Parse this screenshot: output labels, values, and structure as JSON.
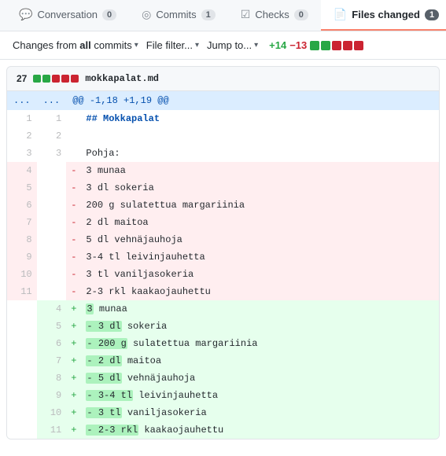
{
  "tabs": [
    {
      "id": "conversation",
      "label": "Conversation",
      "icon": "💬",
      "badge": "0",
      "active": false
    },
    {
      "id": "commits",
      "label": "Commits",
      "icon": "◎",
      "badge": "1",
      "active": false
    },
    {
      "id": "checks",
      "label": "Checks",
      "icon": "☑",
      "badge": "0",
      "active": false
    },
    {
      "id": "files-changed",
      "label": "Files changed",
      "icon": "📄",
      "badge": "1",
      "active": true
    }
  ],
  "filters": {
    "commits": "Changes from all commits",
    "commits_caret": "▾",
    "file_filter": "File filter...",
    "file_filter_caret": "▾",
    "jump_to": "Jump to...",
    "jump_to_caret": "▾",
    "diff_add": "+14",
    "diff_del": "−13",
    "blocks": [
      "green",
      "green",
      "red",
      "red",
      "red"
    ]
  },
  "file": {
    "count": "27",
    "blocks": [
      "green",
      "green",
      "red",
      "red",
      "red"
    ],
    "name": "mokkapalat.md",
    "hunk": "@@ -1,18 +1,19 @@",
    "lines": [
      {
        "type": "ctx",
        "old": "1",
        "new": "1",
        "marker": " ",
        "content": "## Mokkapalat",
        "bold": true
      },
      {
        "type": "ctx",
        "old": "2",
        "new": "2",
        "marker": " ",
        "content": ""
      },
      {
        "type": "ctx",
        "old": "3",
        "new": "3",
        "marker": " ",
        "content": "Pohja:"
      },
      {
        "type": "del",
        "old": "4",
        "new": "",
        "marker": "-",
        "content": "   3      munaa"
      },
      {
        "type": "del",
        "old": "5",
        "new": "",
        "marker": "-",
        "content": "   3 dl   sokeria"
      },
      {
        "type": "del",
        "old": "6",
        "new": "",
        "marker": "-",
        "content": "   200 g  sulatettua margariinia"
      },
      {
        "type": "del",
        "old": "7",
        "new": "",
        "marker": "-",
        "content": "   2 dl   maitoa"
      },
      {
        "type": "del",
        "old": "8",
        "new": "",
        "marker": "-",
        "content": "   5 dl   vehnäjauhoja"
      },
      {
        "type": "del",
        "old": "9",
        "new": "",
        "marker": "-",
        "content": "   3-4 tl leivinjauhetta"
      },
      {
        "type": "del",
        "old": "10",
        "new": "",
        "marker": "-",
        "content": "   3 tl   vaniljasokeria"
      },
      {
        "type": "del",
        "old": "11",
        "new": "",
        "marker": "-",
        "content": "   2-3 rkl kaakaojauhettu"
      },
      {
        "type": "add",
        "old": "",
        "new": "4",
        "marker": "+",
        "content": "   3      munaa",
        "segments": [
          {
            "type": "plain",
            "text": "   "
          },
          {
            "type": "hl",
            "text": "3"
          },
          {
            "type": "plain",
            "text": "      munaa"
          }
        ]
      },
      {
        "type": "add",
        "old": "",
        "new": "5",
        "marker": "+",
        "content": "   - 3 dl   sokeria",
        "segments": [
          {
            "type": "plain",
            "text": "   "
          },
          {
            "type": "hl",
            "text": "- 3 dl"
          },
          {
            "type": "plain",
            "text": "   sokeria"
          }
        ]
      },
      {
        "type": "add",
        "old": "",
        "new": "6",
        "marker": "+",
        "content": "   - 200 g  sulatettua margariinia",
        "segments": [
          {
            "type": "plain",
            "text": "   "
          },
          {
            "type": "hl",
            "text": "- 200 g"
          },
          {
            "type": "plain",
            "text": "  sulatettua margariinia"
          }
        ]
      },
      {
        "type": "add",
        "old": "",
        "new": "7",
        "marker": "+",
        "content": "   - 2 dl   maitoa",
        "segments": [
          {
            "type": "plain",
            "text": "   "
          },
          {
            "type": "hl",
            "text": "- 2 dl"
          },
          {
            "type": "plain",
            "text": "   maitoa"
          }
        ]
      },
      {
        "type": "add",
        "old": "",
        "new": "8",
        "marker": "+",
        "content": "   - 5 dl   vehnäjauhoja",
        "segments": [
          {
            "type": "plain",
            "text": "   "
          },
          {
            "type": "hl",
            "text": "- 5 dl"
          },
          {
            "type": "plain",
            "text": "   vehnäjauhoja"
          }
        ]
      },
      {
        "type": "add",
        "old": "",
        "new": "9",
        "marker": "+",
        "content": "   - 3-4 tl leivinjauhetta",
        "segments": [
          {
            "type": "plain",
            "text": "   "
          },
          {
            "type": "hl",
            "text": "- 3-4 tl"
          },
          {
            "type": "plain",
            "text": " leivinjauhetta"
          }
        ]
      },
      {
        "type": "add",
        "old": "",
        "new": "10",
        "marker": "+",
        "content": "   - 3 tl   vaniljasokeria",
        "segments": [
          {
            "type": "plain",
            "text": "   "
          },
          {
            "type": "hl",
            "text": "- 3 tl"
          },
          {
            "type": "plain",
            "text": "   vaniljasokeria"
          }
        ]
      },
      {
        "type": "add",
        "old": "",
        "new": "11",
        "marker": "+",
        "content": "   - 2-3 rkl kaakaojauhettu",
        "segments": [
          {
            "type": "plain",
            "text": "   "
          },
          {
            "type": "hl",
            "text": "- 2-3 rkl"
          },
          {
            "type": "plain",
            "text": " kaakaojauhettu"
          }
        ]
      }
    ]
  }
}
